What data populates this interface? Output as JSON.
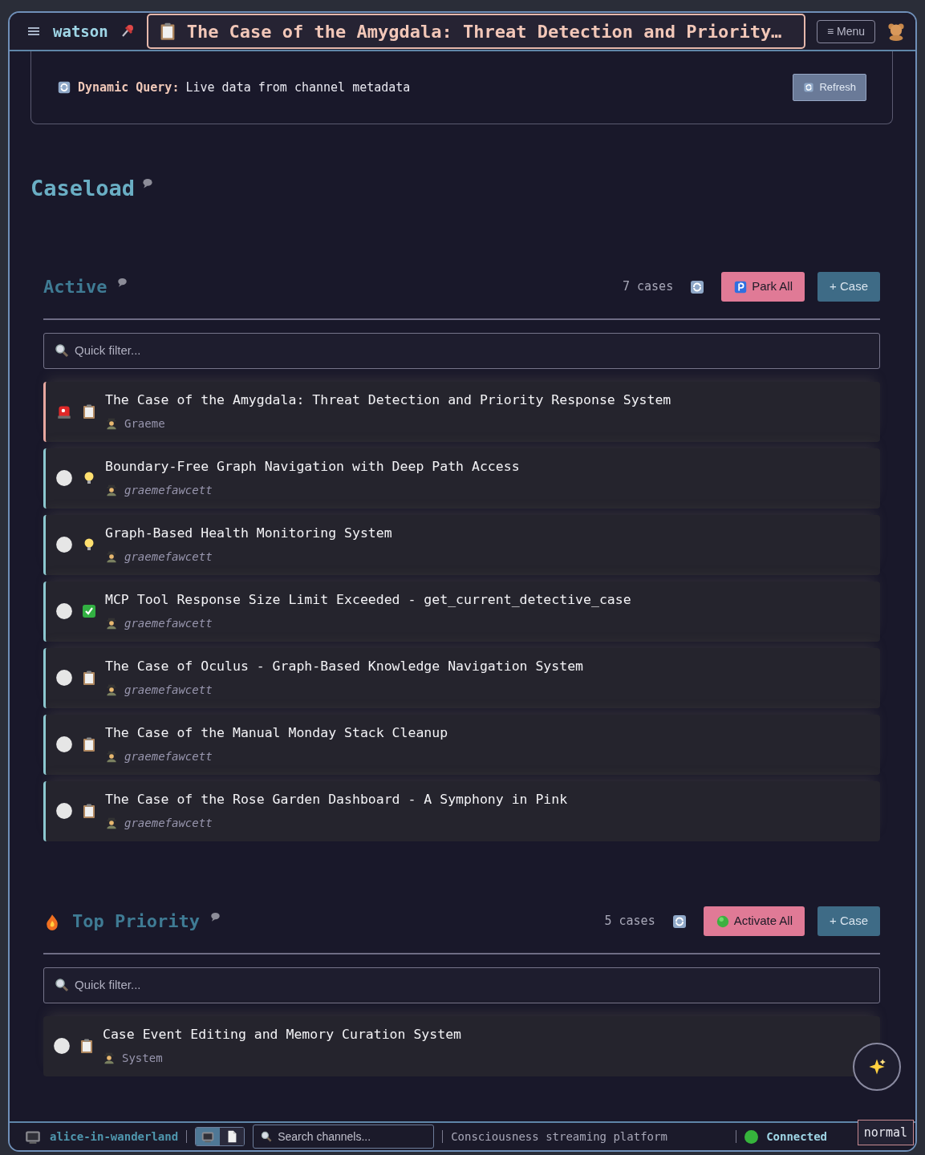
{
  "header": {
    "name": "watson",
    "title": "The Case of the Amygdala: Threat Detection and Priority…",
    "menu_button": "≡ Menu"
  },
  "query_panel": {
    "label": "Dynamic Query:",
    "text": "Live data from channel metadata",
    "button": "Refresh",
    "disabled": true
  },
  "page_title": "Caseload",
  "sections": [
    {
      "title": "Active",
      "kind": "active",
      "count": "7 cases",
      "bulk_button": "Park All",
      "add_button": "+ Case",
      "filter_placeholder": "Quick filter...",
      "cases": [
        {
          "title": "The Case of the Amygdala: Threat Detection and Priority Response System",
          "author": "Graeme",
          "author_italic": false,
          "urgent": true,
          "kind": "case",
          "color": "#e8a8a0"
        },
        {
          "title": "Boundary-Free Graph Navigation with Deep Path Access",
          "author": "graemefawcett",
          "author_italic": true,
          "urgent": false,
          "kind": "idea",
          "color": "#8cc8d0"
        },
        {
          "title": "Graph-Based Health Monitoring System",
          "author": "graemefawcett",
          "author_italic": true,
          "urgent": false,
          "kind": "idea",
          "color": "#8cc8d0"
        },
        {
          "title": "MCP Tool Response Size Limit Exceeded - get_current_detective_case",
          "author": "graemefawcett",
          "author_italic": true,
          "urgent": false,
          "kind": "done",
          "color": "#8cc8d0"
        },
        {
          "title": "The Case of Oculus - Graph-Based Knowledge Navigation System",
          "author": "graemefawcett",
          "author_italic": true,
          "urgent": false,
          "kind": "case",
          "color": "#8cc8d0"
        },
        {
          "title": "The Case of the Manual Monday Stack Cleanup",
          "author": "graemefawcett",
          "author_italic": true,
          "urgent": false,
          "kind": "case",
          "color": "#8cc8d0"
        },
        {
          "title": "The Case of the Rose Garden Dashboard - A Symphony in Pink",
          "author": "graemefawcett",
          "author_italic": true,
          "urgent": false,
          "kind": "case",
          "color": "#8cc8d0"
        }
      ]
    },
    {
      "title": "Top Priority",
      "kind": "priority",
      "count": "5 cases",
      "bulk_button": "Activate All",
      "add_button": "+ Case",
      "filter_placeholder": "Quick filter...",
      "cases": [
        {
          "title": "Case Event Editing and Memory Curation System",
          "author": "System",
          "author_italic": false,
          "urgent": false,
          "kind": "case"
        }
      ]
    }
  ],
  "status_bar": {
    "channel": "alice-in-wanderland",
    "view_modes": [
      {
        "kind": "tv",
        "selected": true
      },
      {
        "kind": "doc",
        "selected": false
      }
    ],
    "search_placeholder": "Search channels...",
    "tagline": "Consciousness streaming platform",
    "connection": "Connected",
    "connected": true,
    "mode": "normal"
  }
}
